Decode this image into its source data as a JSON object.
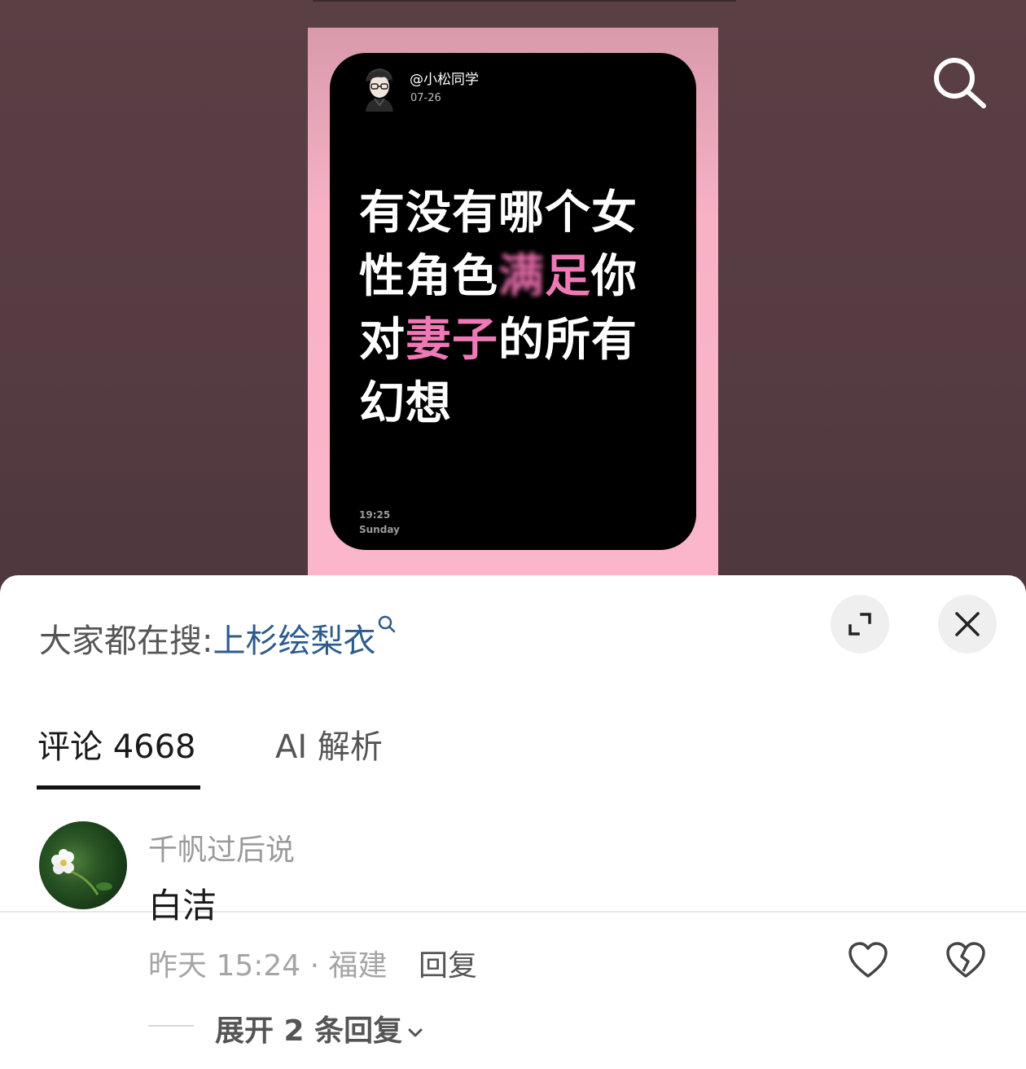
{
  "post": {
    "handle": "@小松同学",
    "date": "07-26",
    "text_parts": {
      "l1": "有没有哪个女",
      "l2a": "性角色",
      "l2b": "满",
      "l2c": "足",
      "l2d": "你",
      "l3a": "对",
      "l3b": "妻子",
      "l3c": "的所有",
      "l4": "幻想"
    },
    "time": "19:25",
    "weekday": "Sunday"
  },
  "sheet": {
    "trending_prefix": "大家都在搜:",
    "trending_keyword": "上杉绘梨衣",
    "tabs": [
      {
        "label": "评论 4668"
      },
      {
        "label": "AI 解析"
      }
    ]
  },
  "comment": {
    "username": "千帆过后说",
    "text": "白洁",
    "meta": "昨天 15:24 · 福建",
    "reply_label": "回复",
    "expand_label": "展开 2 条回复"
  },
  "colors": {
    "frame_pink": "#fbb6cb",
    "highlight_pink": "#ef79b6",
    "keyword_blue": "#2d5b8c"
  },
  "icons": [
    "search-icon",
    "expand-icon",
    "close-icon",
    "heart-icon",
    "broken-heart-icon",
    "chevron-down-icon"
  ]
}
